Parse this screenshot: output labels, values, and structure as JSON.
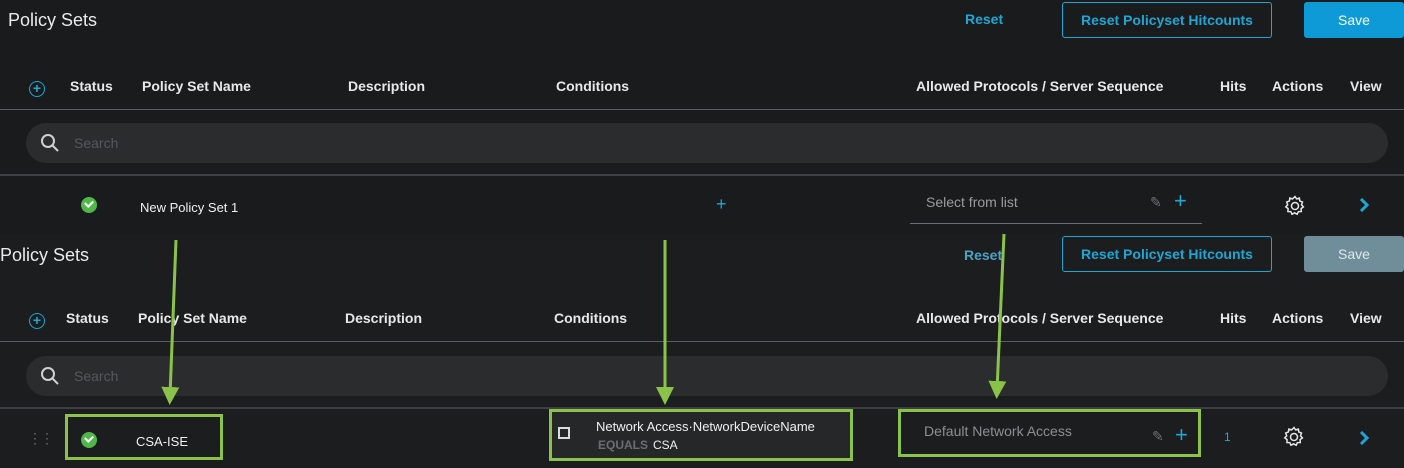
{
  "top": {
    "title": "Policy Sets",
    "reset_label": "Reset",
    "reset_hitcounts_label": "Reset Policyset Hitcounts",
    "save_label": "Save",
    "columns": {
      "status": "Status",
      "name": "Policy Set Name",
      "description": "Description",
      "conditions": "Conditions",
      "protocols": "Allowed Protocols / Server Sequence",
      "hits": "Hits",
      "actions": "Actions",
      "view": "View"
    },
    "search_placeholder": "Search",
    "row": {
      "name": "New Policy Set 1",
      "conditions_add": "+",
      "protocol_placeholder": "Select from list"
    }
  },
  "bottom": {
    "title": "Policy Sets",
    "reset_label": "Reset",
    "reset_hitcounts_label": "Reset Policyset Hitcounts",
    "save_label": "Save",
    "columns": {
      "status": "Status",
      "name": "Policy Set Name",
      "description": "Description",
      "conditions": "Conditions",
      "protocols": "Allowed Protocols / Server Sequence",
      "hits": "Hits",
      "actions": "Actions",
      "view": "View"
    },
    "search_placeholder": "Search",
    "row": {
      "name": "CSA-ISE",
      "condition_attribute": "Network Access·NetworkDeviceName",
      "condition_operator": "EQUALS",
      "condition_value": "CSA",
      "protocol_value": "Default Network Access",
      "hits": "1"
    }
  },
  "colors": {
    "accent": "#1ea7d4",
    "highlight": "#8bc34a",
    "status_ok": "#4fb848"
  }
}
